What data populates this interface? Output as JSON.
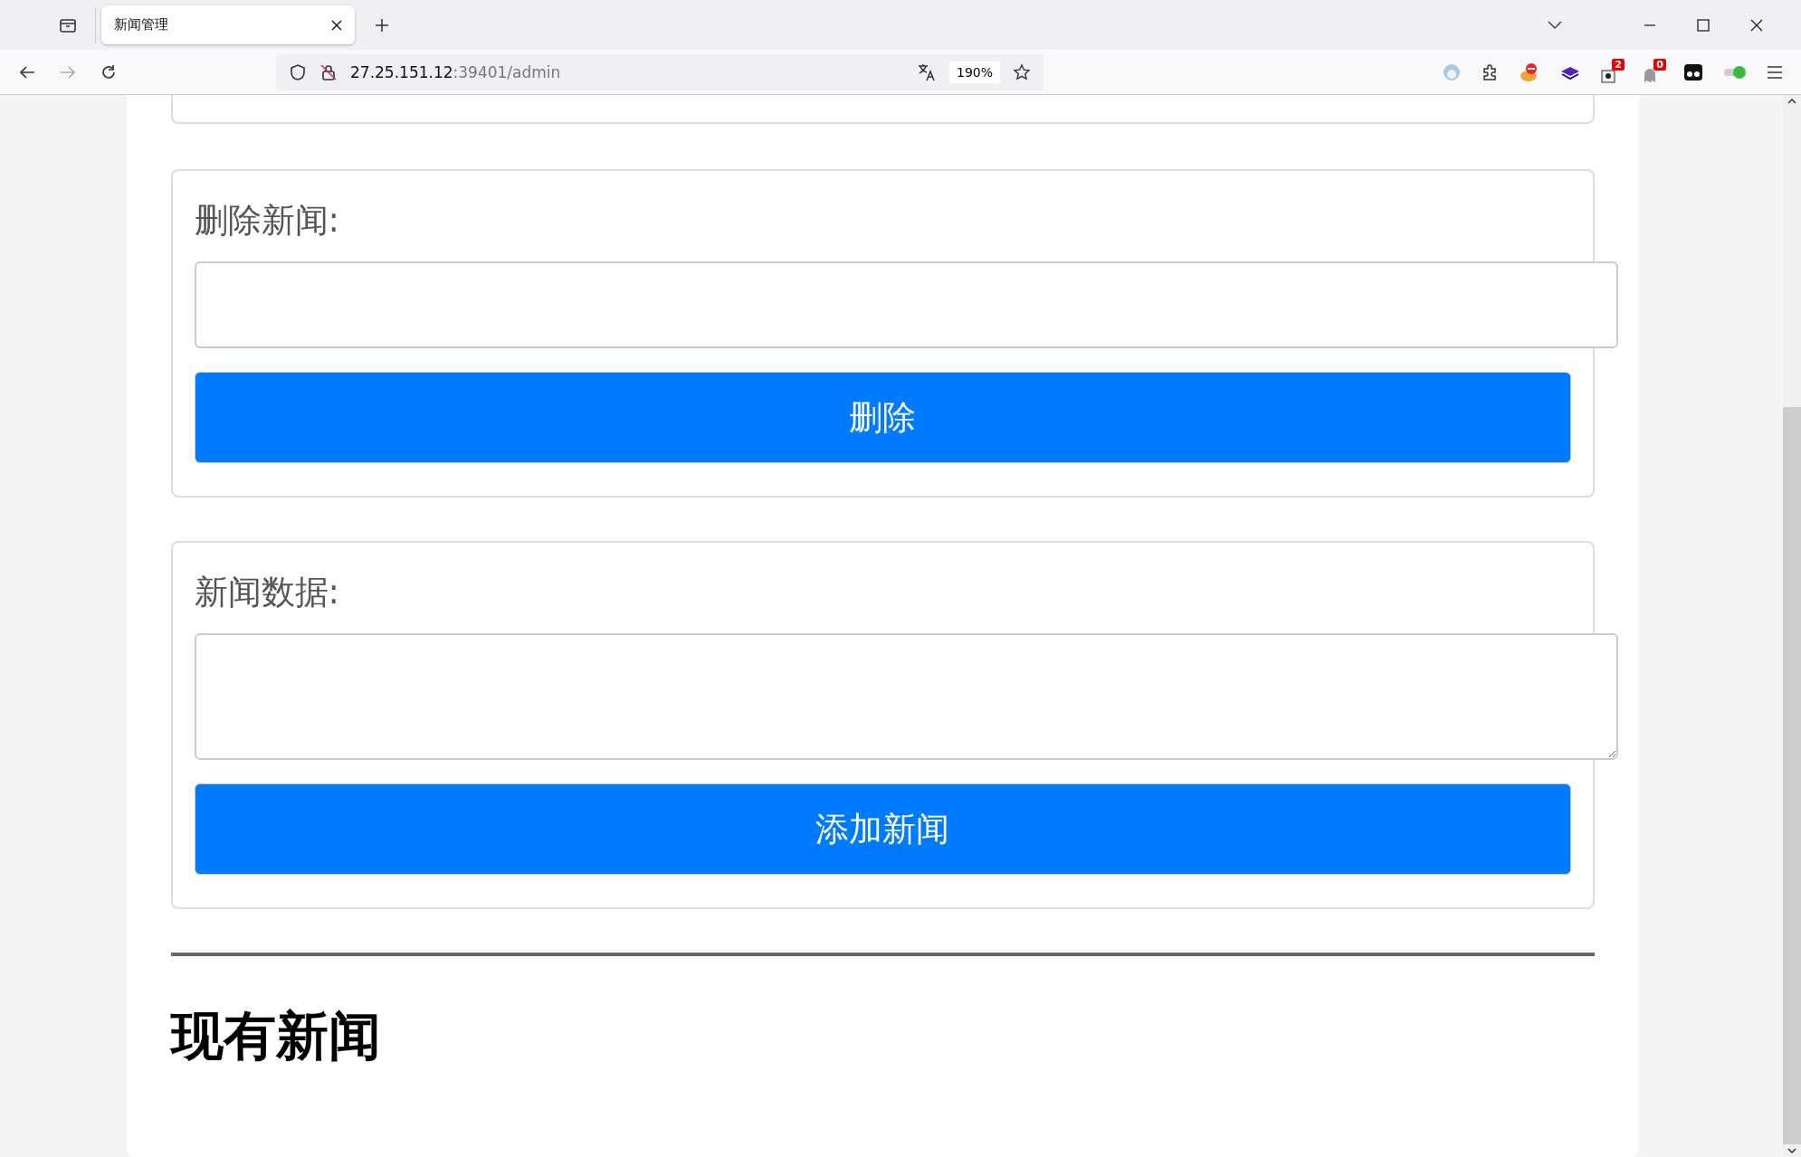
{
  "browser": {
    "tab": {
      "title": "新闻管理",
      "selected": true
    },
    "address": {
      "host": "27.25.151.12",
      "path": ":39401/admin"
    },
    "zoom": "190%",
    "extension_badges": [
      {
        "kind": "card",
        "count": "2"
      },
      {
        "kind": "ghost",
        "count": "0"
      }
    ]
  },
  "forms": [
    {
      "kind": "input",
      "label": "删除新闻:",
      "button": "删除"
    },
    {
      "kind": "textarea",
      "label": "新闻数据:",
      "button": "添加新闻"
    }
  ],
  "section_heading": "现有新闻"
}
